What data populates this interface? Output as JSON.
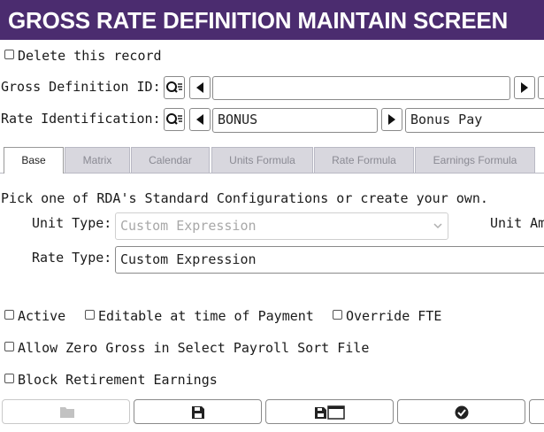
{
  "header": {
    "title": "GROSS RATE DEFINITION MAINTAIN SCREEN"
  },
  "delete": {
    "label": "Delete this record",
    "checked": false
  },
  "gross_definition": {
    "label": "Gross Definition ID:",
    "value": ""
  },
  "rate_identification": {
    "label": "Rate Identification:",
    "value": "BONUS",
    "description": "Bonus Pay"
  },
  "tabs": [
    "Base",
    "Matrix",
    "Calendar",
    "Units Formula",
    "Rate Formula",
    "Earnings Formula"
  ],
  "base": {
    "intro": "Pick one of RDA's Standard Configurations or create your own.",
    "unit_type": {
      "label": "Unit Type:",
      "value": "Custom Expression"
    },
    "unit_amount_label": "Unit Am",
    "rate_type": {
      "label": "Rate Type:",
      "value": "Custom Expression"
    }
  },
  "options": {
    "active": "Active",
    "editable": "Editable at time of Payment",
    "override_fte": "Override FTE",
    "allow_zero": "Allow Zero Gross in Select Payroll Sort File",
    "block_retirement": "Block Retirement Earnings"
  },
  "colors": {
    "header_bg": "#4b2c6f",
    "tab_inactive_bg": "#d8d7de"
  },
  "toolbar_icons": [
    "folder-icon",
    "save-icon",
    "save-new-icon",
    "check-icon"
  ]
}
